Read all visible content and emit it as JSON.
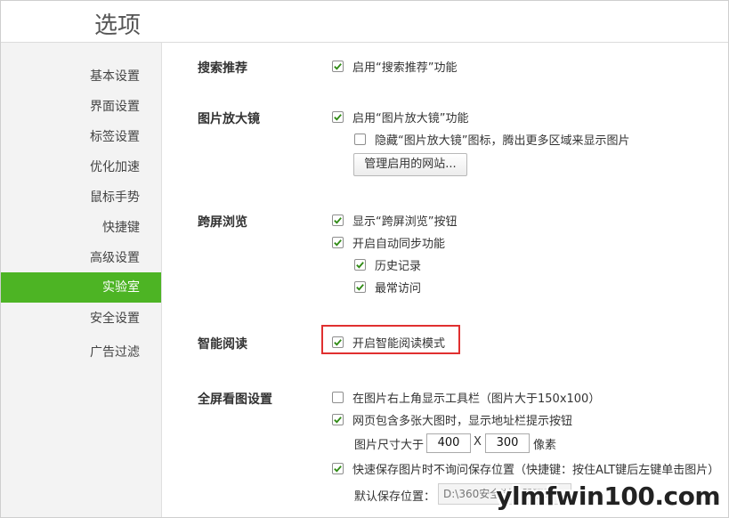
{
  "window": {
    "title": "选项"
  },
  "sidebar": {
    "items": [
      {
        "label": "基本设置"
      },
      {
        "label": "界面设置"
      },
      {
        "label": "标签设置"
      },
      {
        "label": "优化加速"
      },
      {
        "label": "鼠标手势"
      },
      {
        "label": "快捷键"
      },
      {
        "label": "高级设置"
      },
      {
        "label": "实验室",
        "active": true
      },
      {
        "label": "安全设置"
      },
      {
        "label": "广告过滤"
      }
    ]
  },
  "sections": {
    "search": {
      "label": "搜索推荐",
      "enable": {
        "label": "启用“搜索推荐”功能",
        "checked": true
      }
    },
    "magnifier": {
      "label": "图片放大镜",
      "enable": {
        "label": "启用“图片放大镜”功能",
        "checked": true
      },
      "hide_icon": {
        "label": "隐藏“图片放大镜”图标，腾出更多区域来显示图片",
        "checked": false
      },
      "manage_button": "管理启用的网站..."
    },
    "cross_screen": {
      "label": "跨屏浏览",
      "show_button": {
        "label": "显示“跨屏浏览”按钮",
        "checked": true
      },
      "auto_sync": {
        "label": "开启自动同步功能",
        "checked": true
      },
      "history": {
        "label": "历史记录",
        "checked": true
      },
      "frequent": {
        "label": "最常访问",
        "checked": true
      }
    },
    "smart_read": {
      "label": "智能阅读",
      "enable": {
        "label": "开启智能阅读模式",
        "checked": true
      }
    },
    "fullscreen": {
      "label": "全屏看图设置",
      "toolbar": {
        "label": "在图片右上角显示工具栏（图片大于150x100）",
        "checked": false
      },
      "address_hint": {
        "label": "网页包含多张大图时，显示地址栏提示按钮",
        "checked": true
      },
      "size_prefix": "图片尺寸大于",
      "width": "400",
      "size_sep": "X",
      "height": "300",
      "size_unit": "像素",
      "quick_save": {
        "label": "快速保存图片时不询问保存位置（快捷键：按住ALT键后左键单击图片）",
        "checked": true
      },
      "default_path_label": "默认保存位置：",
      "default_path": "D:\\360安全浏览器下载"
    }
  },
  "watermark": "ylmfwin100.com",
  "colors": {
    "accent": "#4db424",
    "highlight": "#e03030",
    "check": "#2f8a14"
  }
}
